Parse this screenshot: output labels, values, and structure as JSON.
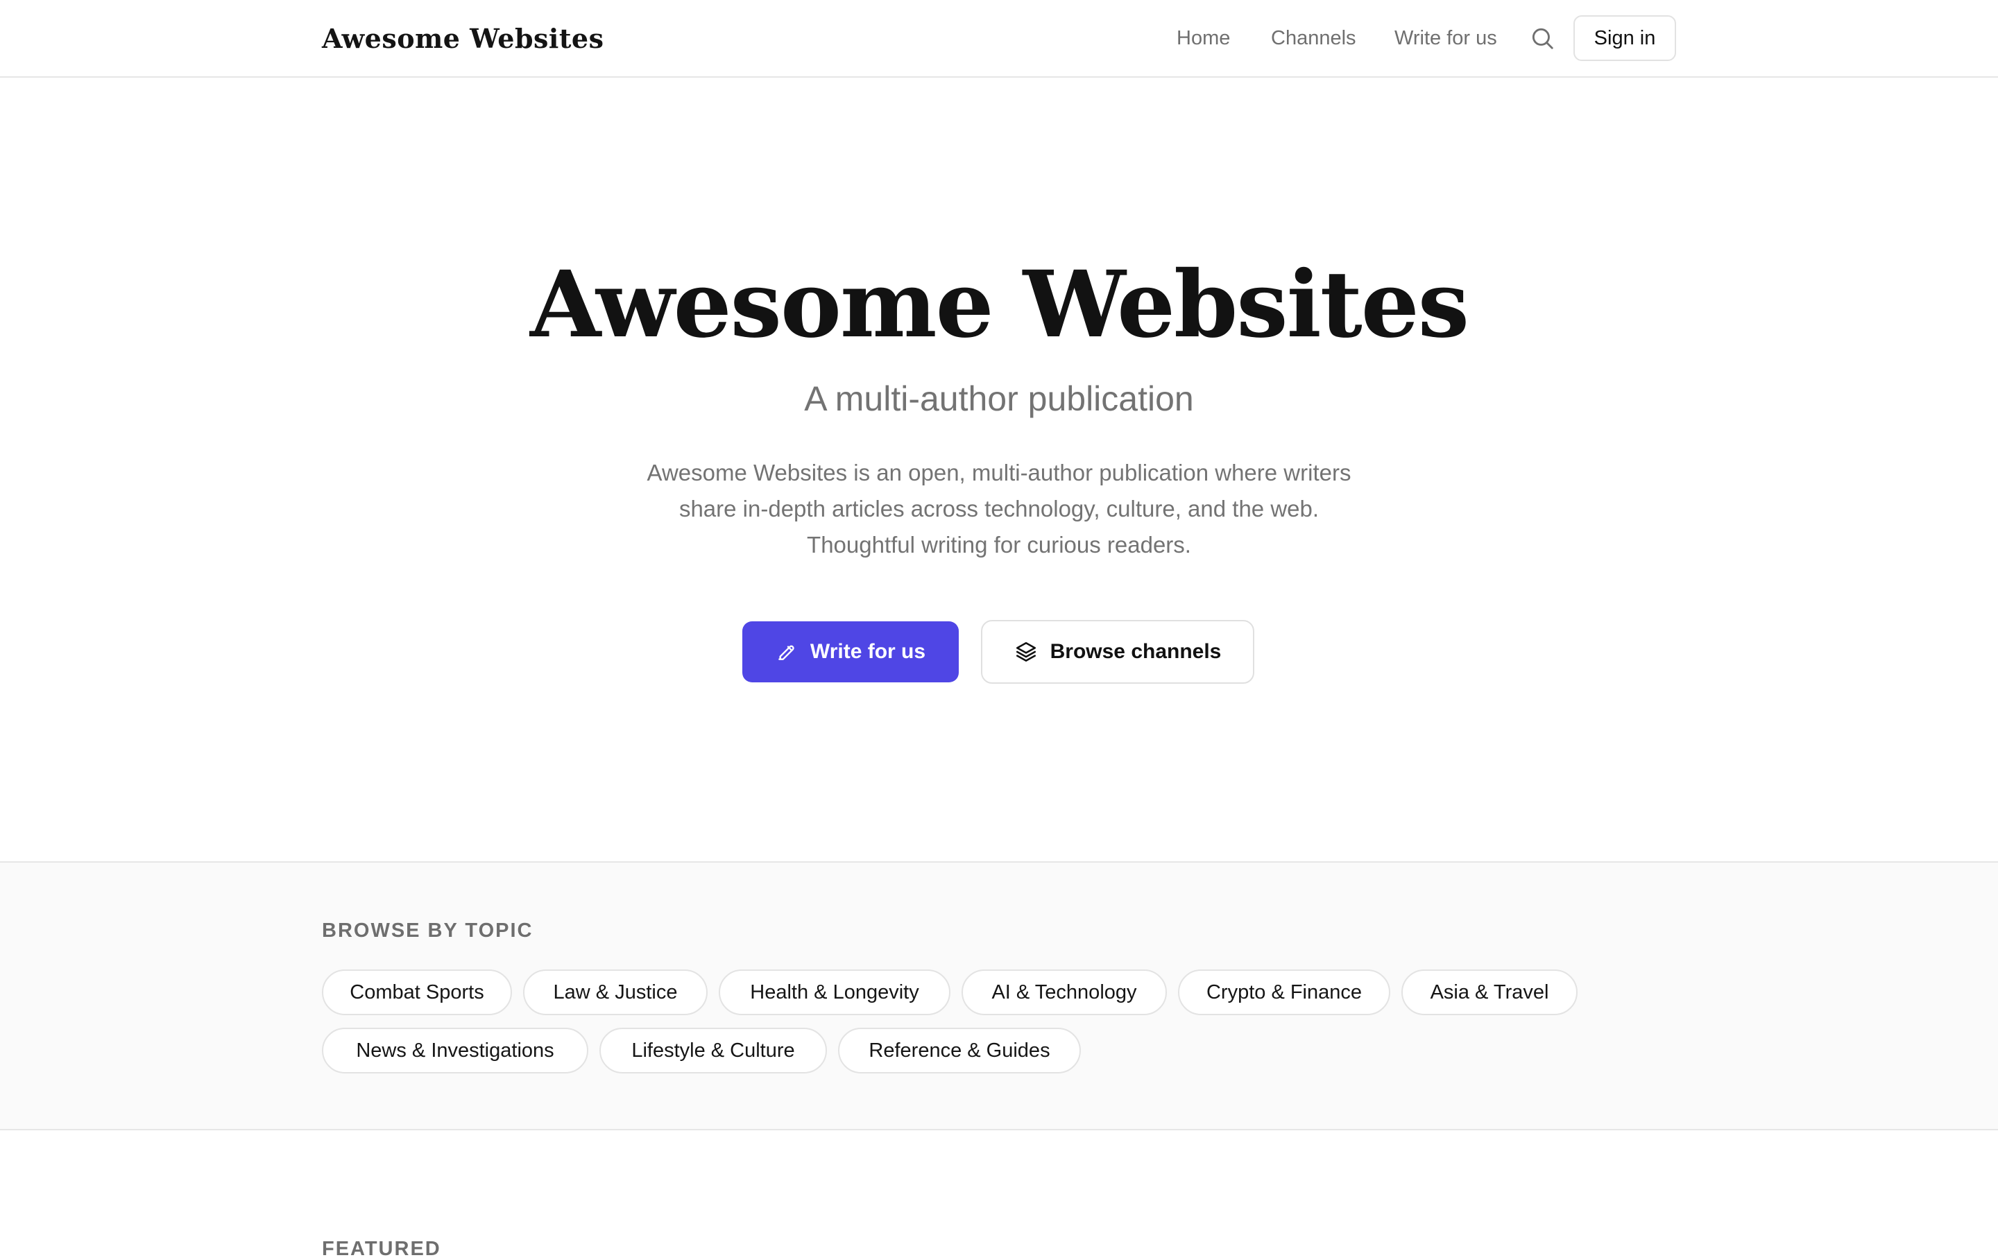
{
  "header": {
    "logo": "Awesome Websites",
    "nav": [
      "Home",
      "Channels",
      "Write for us"
    ],
    "search_icon": "search-icon",
    "signin_label": "Sign in"
  },
  "hero": {
    "title": "Awesome Websites",
    "subtitle": "A multi-author publication",
    "description_lines": [
      "Awesome Websites is an open, multi-author publication where writers",
      "share in-depth articles across technology, culture, and the web.",
      "Thoughtful writing for curious readers."
    ],
    "primary_button": {
      "label": "Write for us",
      "icon": "pencil-icon"
    },
    "secondary_button": {
      "label": "Browse channels",
      "icon": "layers-icon"
    }
  },
  "topics": {
    "label": "BROWSE BY TOPIC",
    "chips": [
      "Combat Sports",
      "Law & Justice",
      "Health & Longevity",
      "AI & Technology",
      "Crypto & Finance",
      "Asia & Travel",
      "News & Investigations",
      "Lifestyle & Culture",
      "Reference & Guides"
    ]
  },
  "featured": {
    "label": "FEATURED"
  },
  "colors": {
    "accent": "#4f46e5",
    "text": "#111111",
    "muted": "#737373",
    "border": "#e3e3e3",
    "section_bg": "#fafafa"
  }
}
